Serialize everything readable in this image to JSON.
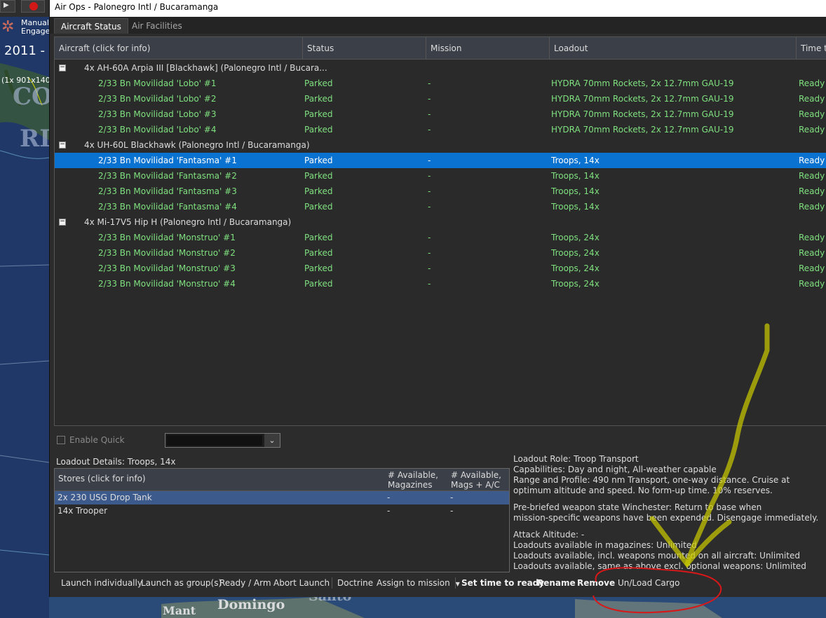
{
  "map": {
    "year": "2011 -",
    "coord": "(1x 901x140",
    "manual_line1": "Manual",
    "manual_line2": "Engage",
    "label_co": "CO",
    "label_ri": "RI",
    "label_domingo": "Domingo",
    "label_santo": "Santo",
    "label_mant": "Mant"
  },
  "window": {
    "title": "Air Ops - Palonegro Intl / Bucaramanga"
  },
  "tabs": [
    {
      "label": "Aircraft Status"
    },
    {
      "label": "Air Facilities"
    }
  ],
  "columns": [
    "Aircraft (click for info)",
    "Status",
    "Mission",
    "Loadout",
    "Time to"
  ],
  "groups": [
    {
      "name": "4x AH-60A Arpia III [Blackhawk] (Palonegro Intl / Bucara...",
      "rows": [
        [
          "2/33 Bn Movilidad 'Lobo'  #1",
          "Parked",
          "-",
          "HYDRA 70mm Rockets, 2x 12.7mm GAU-19",
          "Ready"
        ],
        [
          "2/33 Bn Movilidad 'Lobo'  #2",
          "Parked",
          "-",
          "HYDRA 70mm Rockets, 2x 12.7mm GAU-19",
          "Ready"
        ],
        [
          "2/33 Bn Movilidad 'Lobo'  #3",
          "Parked",
          "-",
          "HYDRA 70mm Rockets, 2x 12.7mm GAU-19",
          "Ready"
        ],
        [
          "2/33 Bn Movilidad 'Lobo'  #4",
          "Parked",
          "-",
          "HYDRA 70mm Rockets, 2x 12.7mm GAU-19",
          "Ready"
        ]
      ]
    },
    {
      "name": "4x UH-60L Blackhawk (Palonegro Intl / Bucaramanga)",
      "rows": [
        [
          "2/33 Bn Movilidad 'Fantasma'  #1",
          "Parked",
          "-",
          "Troops, 14x",
          "Ready"
        ],
        [
          "2/33 Bn Movilidad 'Fantasma'  #2",
          "Parked",
          "-",
          "Troops, 14x",
          "Ready"
        ],
        [
          "2/33 Bn Movilidad 'Fantasma'  #3",
          "Parked",
          "-",
          "Troops, 14x",
          "Ready"
        ],
        [
          "2/33 Bn Movilidad 'Fantasma'  #4",
          "Parked",
          "-",
          "Troops, 14x",
          "Ready"
        ]
      ]
    },
    {
      "name": "4x Mi-17V5 Hip H (Palonegro Intl / Bucaramanga)",
      "rows": [
        [
          "2/33 Bn Movilidad 'Monstruo'  #1",
          "Parked",
          "-",
          "Troops, 24x",
          "Ready"
        ],
        [
          "2/33 Bn Movilidad 'Monstruo'  #2",
          "Parked",
          "-",
          "Troops, 24x",
          "Ready"
        ],
        [
          "2/33 Bn Movilidad 'Monstruo'  #3",
          "Parked",
          "-",
          "Troops, 24x",
          "Ready"
        ],
        [
          "2/33 Bn Movilidad 'Monstruo'  #4",
          "Parked",
          "-",
          "Troops, 24x",
          "Ready"
        ]
      ]
    }
  ],
  "quick": {
    "label": "Enable Quick"
  },
  "loadout": {
    "title": "Loadout Details: Troops, 14x",
    "headers": [
      "Stores (click for info)",
      "# Available,\nMagazines",
      "# Available,\nMags + A/C"
    ],
    "rows": [
      [
        "2x 230 USG Drop Tank",
        "-",
        "-"
      ],
      [
        "14x Trooper",
        "-",
        "-"
      ]
    ]
  },
  "info": {
    "role": "Loadout Role: Troop Transport",
    "capabilities": "Capabilities: Day and night, All-weather capable",
    "range1": "Range and Profile: 490 nm Transport, one-way distance. Cruise at",
    "range2": "optimum altitude and speed. No form-up time. 10% reserves.",
    "prebrief1": "Pre-briefed weapon state Winchester: Return to base when",
    "prebrief2": "mission-specific weapons have been expended. Disengage immediately.",
    "attack": "Attack Altitude: -",
    "avail1": "Loadouts available in magazines: Unlimited",
    "avail2": "Loadouts available, incl. weapons mounted on all aircraft: Unlimited",
    "avail3": "Loadouts available, same as above excl. optional weapons: Unlimited"
  },
  "toolbar": {
    "launch_individually": "Launch individually",
    "launch_group": "Launch as group(s)",
    "ready_arm": "Ready / Arm",
    "abort": "Abort Launch",
    "doctrine": "Doctrine",
    "assign": "Assign to mission",
    "set_time": "Set time to ready",
    "rename": "Rename",
    "remove": "Remove",
    "unload": "Un/Load Cargo"
  },
  "colors": {
    "selected_row": "#0a73d1",
    "green_text": "#7fe07f",
    "annotation_yellow": "#c8c800",
    "annotation_red": "#d81818"
  }
}
